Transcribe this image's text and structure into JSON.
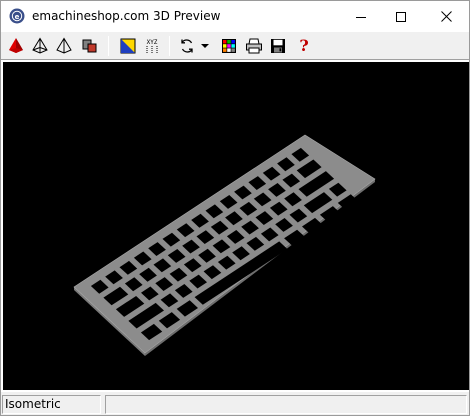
{
  "window": {
    "title": "emachineshop.com 3D Preview",
    "icons": {
      "app": "emachineshop-logo-icon",
      "minimize": "minimize-icon",
      "maximize": "maximize-icon",
      "close": "close-icon"
    }
  },
  "toolbar": {
    "buttons": [
      {
        "name": "shaded-view-button",
        "icon": "red-solid-pyramid-icon"
      },
      {
        "name": "wireframe-view-button",
        "icon": "wireframe-pyramid-icon"
      },
      {
        "name": "outline-view-button",
        "icon": "outline-pyramid-icon"
      },
      {
        "name": "parts-view-button",
        "icon": "parts-icon"
      },
      {
        "name": "material-button",
        "icon": "material-swatch-icon"
      },
      {
        "name": "axes-button",
        "icon": "xyz-axes-icon"
      },
      {
        "name": "rotate-button",
        "icon": "rotate-icon"
      },
      {
        "name": "rotate-dropdown-button",
        "icon": "dropdown-arrow-icon"
      },
      {
        "name": "color-button",
        "icon": "color-palette-icon"
      },
      {
        "name": "print-button",
        "icon": "printer-icon"
      },
      {
        "name": "save-button",
        "icon": "floppy-disk-icon"
      },
      {
        "name": "help-button",
        "icon": "help-icon"
      }
    ],
    "axes_label": "XYZ",
    "help_label": "?"
  },
  "viewport": {
    "background": "#000000",
    "model_color": "#8c8c8c",
    "model": "keyboard-plate"
  },
  "statusbar": {
    "view_mode": "Isometric",
    "secondary": ""
  }
}
